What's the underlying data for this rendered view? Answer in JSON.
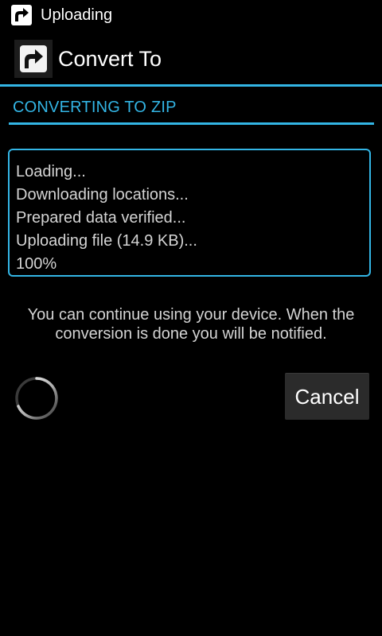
{
  "status_bar": {
    "icon": "convert-arrow-icon",
    "title": "Uploading"
  },
  "action_bar": {
    "icon": "convert-arrow-icon",
    "title": "Convert To"
  },
  "dialog": {
    "title": "CONVERTING TO ZIP",
    "log_lines": [
      "Loading...",
      "Downloading locations...",
      "Prepared data verified...",
      "Uploading file (14.9 KB)...",
      "100%"
    ],
    "info": "You can continue using your device. When the conversion is done you will be notified.",
    "cancel_label": "Cancel"
  },
  "colors": {
    "accent": "#33b5e5",
    "background": "#000000",
    "text_secondary": "#d4d4d4"
  }
}
